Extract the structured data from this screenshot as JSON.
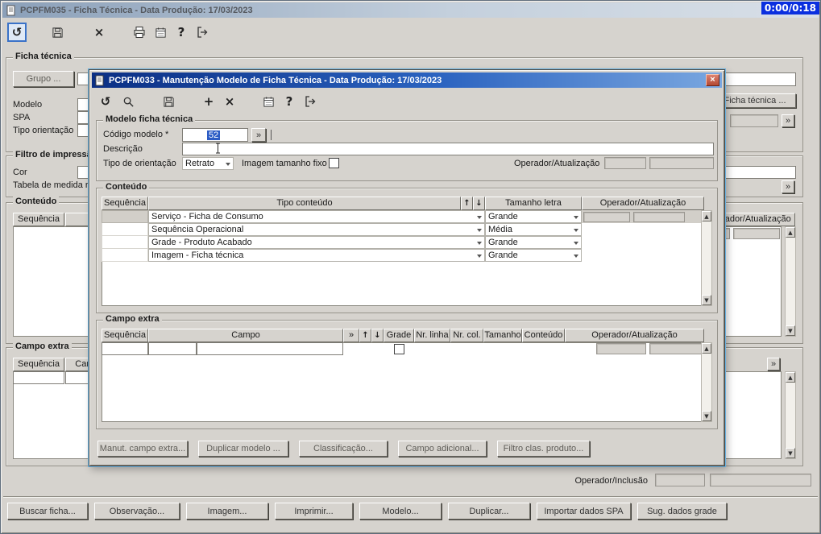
{
  "timer": "0:00/0:18",
  "icons": {
    "undo": "↺",
    "close": "×",
    "plus": "+",
    "help": "?",
    "more": "»",
    "up": "↑",
    "down": "↓",
    "scroll_up": "▲",
    "scroll_down": "▼"
  },
  "main_window": {
    "title": "PCPFM035 - Ficha Técnica - Data Produção: 17/03/2023",
    "ficha_tecnica": {
      "legend": "Ficha técnica",
      "grupo_button": "Grupo ...",
      "modelo_label": "Modelo",
      "spa_label": "SPA",
      "tipo_orientacao_label": "Tipo orientação",
      "ficha_tecnica_button": "Ficha técnica ..."
    },
    "filtro_impressao": {
      "legend": "Filtro de impressão",
      "cor_label": "Cor",
      "tabela_label": "Tabela de medida referência"
    },
    "conteudo": {
      "legend": "Conteúdo",
      "sequencia_header": "Sequência",
      "operador_header": "Operador/Atualização"
    },
    "campo_extra": {
      "legend": "Campo extra",
      "sequencia_header": "Sequência",
      "campo_header": "Campo"
    },
    "operador_inclusao_label": "Operador/Inclusão",
    "buttons": [
      "Buscar ficha...",
      "Observação...",
      "Imagem...",
      "Imprimir...",
      "Modelo...",
      "Duplicar...",
      "Importar dados SPA",
      "Sug. dados grade"
    ]
  },
  "dialog": {
    "title": "PCPFM033 - Manutenção Modelo de Ficha Técnica - Data Produção: 17/03/2023",
    "modelo": {
      "legend": "Modelo ficha técnica",
      "codigo_label": "Código modelo *",
      "codigo_value": "52",
      "descricao_label": "Descrição",
      "descricao_value": "",
      "tipo_orientacao_label": "Tipo de orientação",
      "tipo_orientacao_value": "Retrato",
      "imagem_fixo_label": "Imagem tamanho fixo",
      "operador_label": "Operador/Atualização"
    },
    "conteudo": {
      "legend": "Conteúdo",
      "headers": {
        "sequencia": "Sequência",
        "tipo": "Tipo conteúdo",
        "tamanho": "Tamanho letra",
        "operador": "Operador/Atualização"
      },
      "rows": [
        {
          "tipo": "Serviço - Ficha de Consumo",
          "tamanho": "Grande"
        },
        {
          "tipo": "Sequência Operacional",
          "tamanho": "Média"
        },
        {
          "tipo": "Grade - Produto Acabado",
          "tamanho": "Grande"
        },
        {
          "tipo": "Imagem - Ficha técnica",
          "tamanho": "Grande"
        }
      ]
    },
    "campo_extra": {
      "legend": "Campo extra",
      "headers": {
        "sequencia": "Sequência",
        "campo": "Campo",
        "grade": "Grade",
        "nr_linha": "Nr. linha",
        "nr_col": "Nr. col.",
        "tamanho": "Tamanho",
        "conteudo": "Conteúdo",
        "operador": "Operador/Atualização"
      }
    },
    "buttons": [
      "Manut. campo extra...",
      "Duplicar modelo ...",
      "Classificação...",
      "Campo adicional...",
      "Filtro clas. produto..."
    ]
  }
}
